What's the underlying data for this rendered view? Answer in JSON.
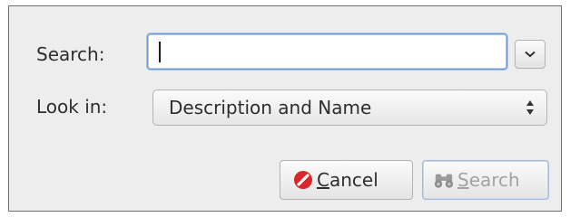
{
  "dialog": {
    "search_label": "Search:",
    "search_value": "",
    "lookin_label": "Look in:",
    "lookin_selected": "Description and Name"
  },
  "buttons": {
    "cancel_mnemonic": "C",
    "cancel_rest": "ancel",
    "search_mnemonic": "S",
    "search_rest": "earch"
  },
  "icons": {
    "cancel": "cancel-icon",
    "search": "binoculars-icon",
    "history_dropdown": "chevron-down-icon",
    "combo": "updown-arrows-icon"
  },
  "colors": {
    "focus": "#6a95cf",
    "cancel_icon": "#d9262a",
    "disabled_text": "#a3a3a3"
  }
}
